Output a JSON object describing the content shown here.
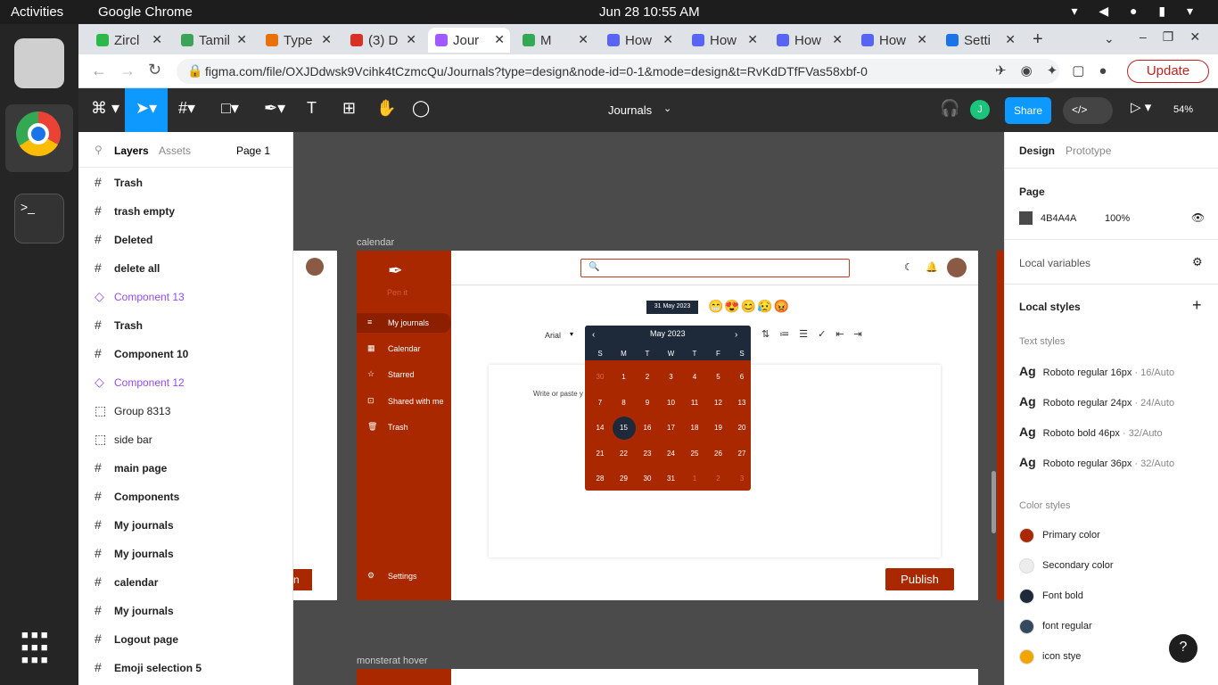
{
  "system": {
    "activities": "Activities",
    "app": "Google Chrome",
    "clock": "Jun 28  10:55 AM"
  },
  "tabs": [
    {
      "label": "Zircl",
      "color": "#2db84b"
    },
    {
      "label": "Tamil",
      "color": "#3da35a"
    },
    {
      "label": "Type",
      "color": "#e8710a"
    },
    {
      "label": "(3) D",
      "color": "#d93025"
    },
    {
      "label": "Jour",
      "color": "#a259ff"
    },
    {
      "label": "M",
      "color": "#34a853"
    },
    {
      "label": "How",
      "color": "#5865f2"
    },
    {
      "label": "How",
      "color": "#5865f2"
    },
    {
      "label": "How",
      "color": "#5865f2"
    },
    {
      "label": "How",
      "color": "#5865f2"
    },
    {
      "label": "Setti",
      "color": "#1a73e8"
    }
  ],
  "address": {
    "url": "figma.com/file/OXJDdwsk9Vcihk4tCzmcQu/Journals?type=design&node-id=0-1&mode=design&t=RvKdDTfFVas58xbf-0",
    "update": "Update"
  },
  "figma": {
    "title": "Journals",
    "share": "Share",
    "zoom": "54%",
    "avatar": "J"
  },
  "layers_panel": {
    "tab_layers": "Layers",
    "tab_assets": "Assets",
    "page": "Page 1",
    "items": [
      {
        "name": "Trash",
        "kind": "frame"
      },
      {
        "name": "trash empty",
        "kind": "frame"
      },
      {
        "name": "Deleted",
        "kind": "frame"
      },
      {
        "name": "delete all",
        "kind": "frame"
      },
      {
        "name": "Component 13",
        "kind": "component"
      },
      {
        "name": "Trash",
        "kind": "frame"
      },
      {
        "name": "Component 10",
        "kind": "frame"
      },
      {
        "name": "Component 12",
        "kind": "component"
      },
      {
        "name": "Group 8313",
        "kind": "group"
      },
      {
        "name": "side bar",
        "kind": "group"
      },
      {
        "name": "main page",
        "kind": "frame"
      },
      {
        "name": "Components",
        "kind": "frame"
      },
      {
        "name": "My journals",
        "kind": "frame"
      },
      {
        "name": "My journals",
        "kind": "frame"
      },
      {
        "name": "calendar",
        "kind": "frame"
      },
      {
        "name": "My journals",
        "kind": "frame"
      },
      {
        "name": "Logout page",
        "kind": "frame"
      },
      {
        "name": "Emoji selection 5",
        "kind": "frame"
      }
    ]
  },
  "canvas": {
    "frame_label": "calendar",
    "frame_label2": "monsterat hover",
    "logo": "Pen it",
    "nav": [
      "My journals",
      "Calendar",
      "Starred",
      "Shared with me",
      "Trash"
    ],
    "settings": "Settings",
    "date_chip": "31 May 2023",
    "font": "Arial",
    "placeholder": "Write or paste y",
    "publish": "Publish",
    "calendar": {
      "month": "May 2023",
      "weekdays": [
        "S",
        "M",
        "T",
        "W",
        "T",
        "F",
        "S"
      ],
      "days": [
        "30",
        "1",
        "2",
        "3",
        "4",
        "5",
        "6",
        "7",
        "8",
        "9",
        "10",
        "11",
        "12",
        "13",
        "14",
        "15",
        "16",
        "17",
        "18",
        "19",
        "20",
        "21",
        "22",
        "23",
        "24",
        "25",
        "26",
        "27",
        "28",
        "29",
        "30",
        "31",
        "1",
        "2",
        "3"
      ],
      "selected": "15"
    }
  },
  "design_panel": {
    "tab_design": "Design",
    "tab_prototype": "Prototype",
    "page_label": "Page",
    "page_color": "4B4A4A",
    "page_opacity": "100%",
    "local_variables": "Local variables",
    "local_styles": "Local styles",
    "text_styles_label": "Text styles",
    "text_styles": [
      {
        "name": "Roboto regular 16px",
        "meta": "· 16/Auto"
      },
      {
        "name": "Roboto regular 24px",
        "meta": "· 24/Auto"
      },
      {
        "name": "Roboto bold 46px",
        "meta": "· 32/Auto"
      },
      {
        "name": "Roboto regular 36px",
        "meta": "· 32/Auto"
      }
    ],
    "color_styles_label": "Color styles",
    "color_styles": [
      {
        "name": "Primary color",
        "color": "#a92800"
      },
      {
        "name": "Secondary color",
        "color": "#ececec"
      },
      {
        "name": "Font bold",
        "color": "#1e2a3a"
      },
      {
        "name": "font regular",
        "color": "#34495e"
      },
      {
        "name": "icon stye",
        "color": "#f0a500"
      }
    ]
  }
}
